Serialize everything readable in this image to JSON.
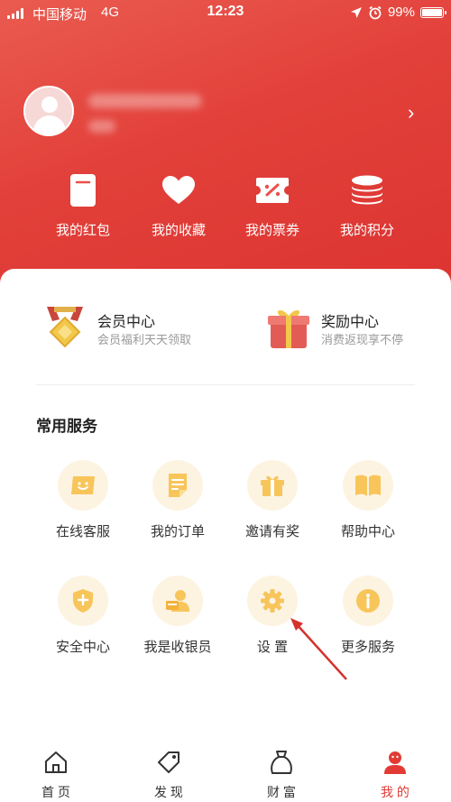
{
  "status_bar": {
    "carrier": "中国移动",
    "network": "4G",
    "time": "12:23",
    "battery": "99%",
    "battery_level": 0.99
  },
  "profile": {
    "chevron": "›"
  },
  "quick_actions": [
    {
      "label": "我的红包",
      "icon": "red-packet-icon"
    },
    {
      "label": "我的收藏",
      "icon": "heart-icon"
    },
    {
      "label": "我的票券",
      "icon": "ticket-icon"
    },
    {
      "label": "我的积分",
      "icon": "coins-icon"
    }
  ],
  "centers": [
    {
      "title": "会员中心",
      "subtitle": "会员福利天天领取",
      "icon": "medal-icon"
    },
    {
      "title": "奖励中心",
      "subtitle": "消费返现享不停",
      "icon": "gift-box-icon"
    }
  ],
  "services": {
    "title": "常用服务",
    "items": [
      {
        "label": "在线客服",
        "icon": "chat-icon"
      },
      {
        "label": "我的订单",
        "icon": "order-icon"
      },
      {
        "label": "邀请有奖",
        "icon": "gift-icon"
      },
      {
        "label": "帮助中心",
        "icon": "book-icon"
      },
      {
        "label": "安全中心",
        "icon": "shield-icon"
      },
      {
        "label": "我是收银员",
        "icon": "cashier-icon"
      },
      {
        "label": "设 置",
        "icon": "gear-icon"
      },
      {
        "label": "更多服务",
        "icon": "info-icon"
      }
    ]
  },
  "tabs": [
    {
      "label": "首 页",
      "icon": "home-icon",
      "active": false
    },
    {
      "label": "发 现",
      "icon": "tag-icon",
      "active": false
    },
    {
      "label": "财 富",
      "icon": "money-bag-icon",
      "active": false
    },
    {
      "label": "我 的",
      "icon": "profile-icon",
      "active": true
    }
  ],
  "colors": {
    "brand_red": "#e23b35",
    "service_icon": "#f7c55a",
    "service_bg": "#fdf3e1"
  }
}
